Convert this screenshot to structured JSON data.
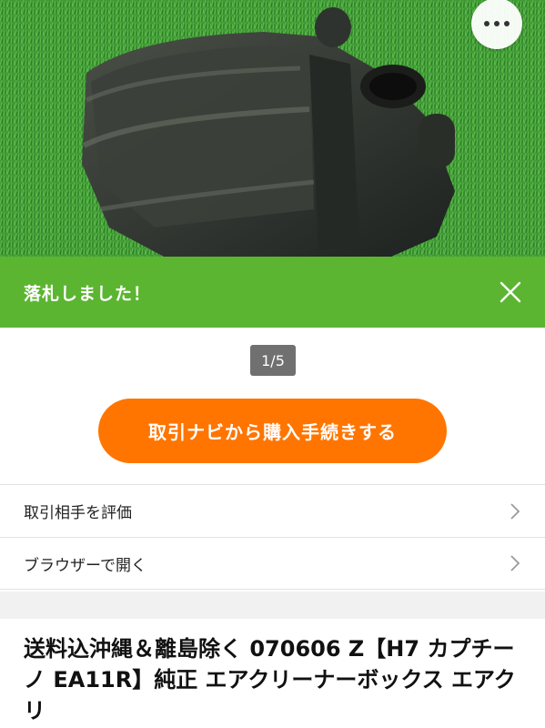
{
  "photo": {
    "alt": "air cleaner box photo",
    "more_icon": "more-horizontal-icon"
  },
  "banner": {
    "text": "落札しました！",
    "close_icon": "close-icon",
    "color": "#5bb531"
  },
  "gallery": {
    "counter": "1/5"
  },
  "cta": {
    "label": "取引ナビから購入手続きする",
    "color": "#ff7500"
  },
  "menu": {
    "items": [
      {
        "label": "取引相手を評価",
        "icon": "chevron-right-icon"
      },
      {
        "label": "ブラウザーで開く",
        "icon": "chevron-right-icon"
      }
    ]
  },
  "item": {
    "title": "送料込沖縄＆離島除く 070606 Z【H7 カプチーノ EA11R】純正 エアクリーナーボックス エアクリ"
  }
}
